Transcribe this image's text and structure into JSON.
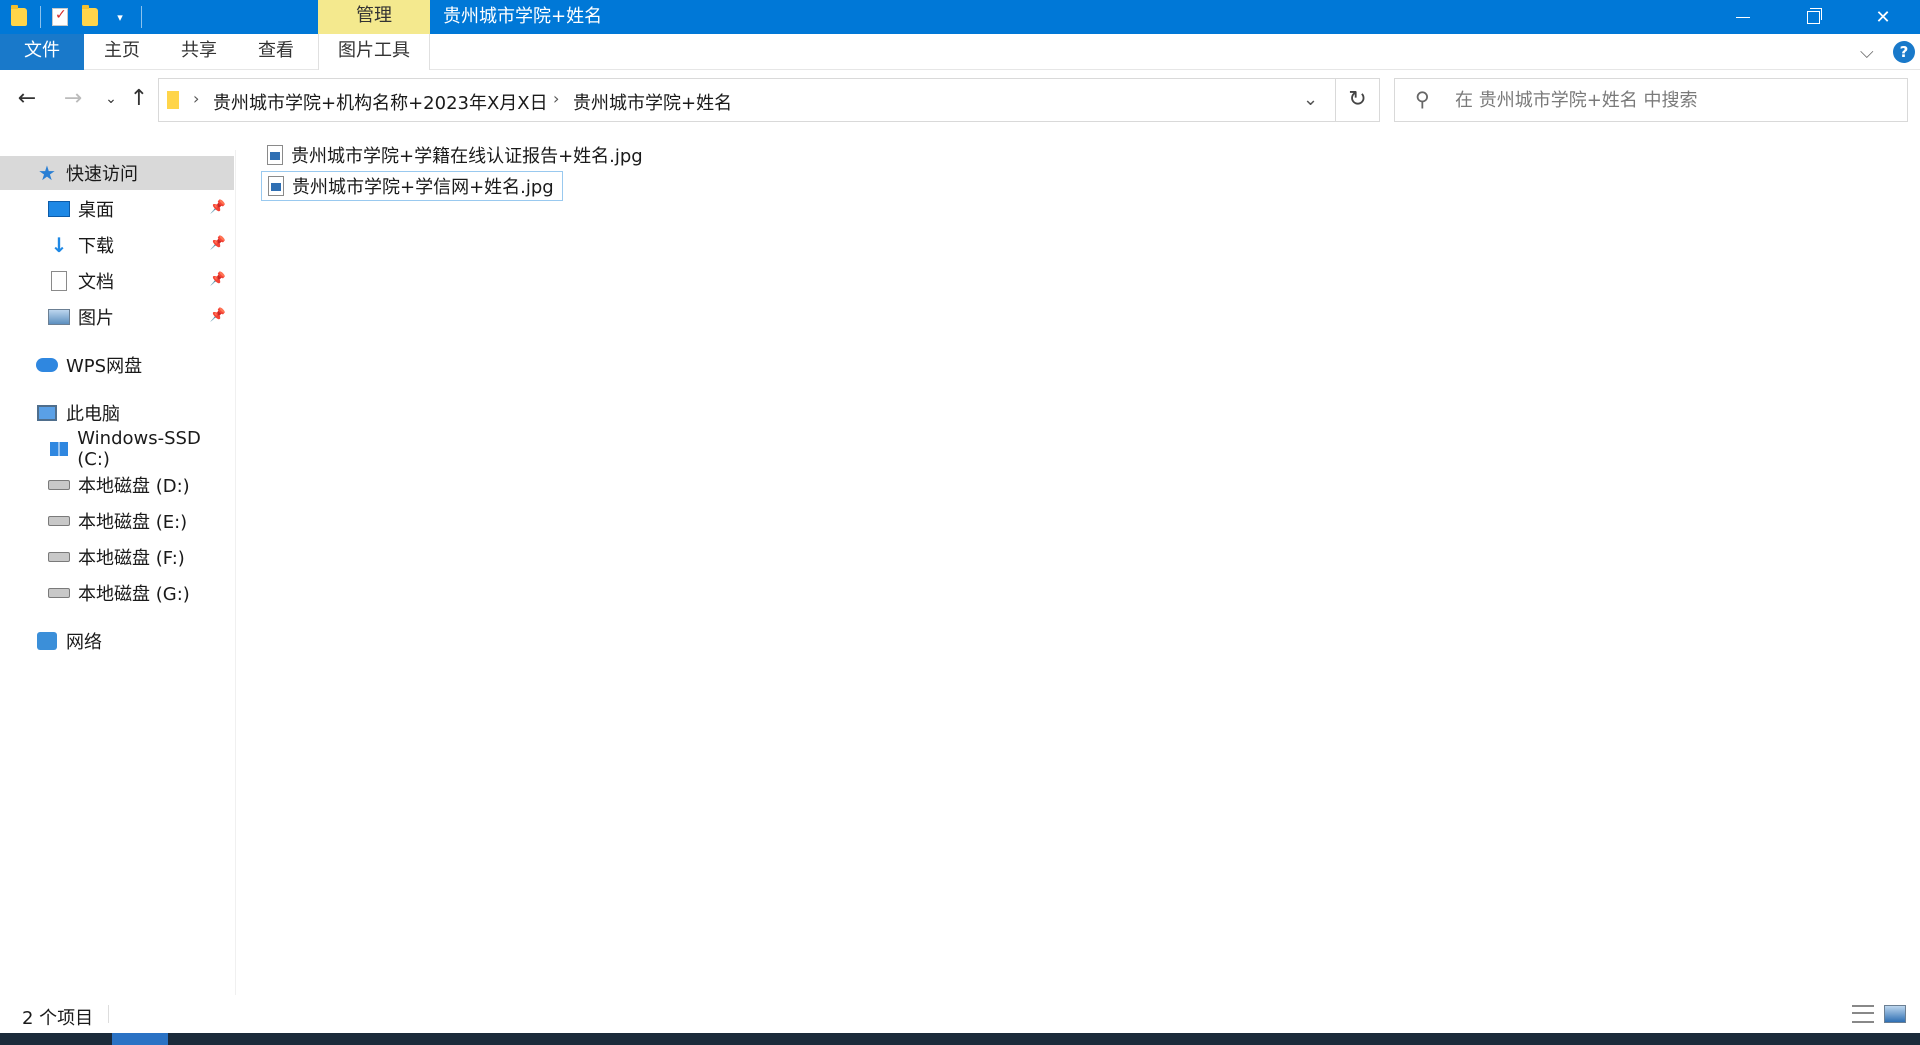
{
  "window": {
    "title": "贵州城市学院+姓名",
    "context_tab": "管理",
    "accent_color": "#0078d7"
  },
  "ribbon": {
    "tabs": [
      "文件",
      "主页",
      "共享",
      "查看",
      "图片工具"
    ]
  },
  "address": {
    "segments": [
      "贵州城市学院+机构名称+2023年X月X日",
      "贵州城市学院+姓名"
    ]
  },
  "search": {
    "placeholder": "在 贵州城市学院+姓名 中搜索"
  },
  "sidebar": {
    "quick_access": "快速访问",
    "pinned": [
      "桌面",
      "下载",
      "文档",
      "图片"
    ],
    "wps": "WPS网盘",
    "this_pc": "此电脑",
    "drives": [
      "Windows-SSD (C:)",
      "本地磁盘 (D:)",
      "本地磁盘 (E:)",
      "本地磁盘 (F:)",
      "本地磁盘 (G:)"
    ],
    "network": "网络"
  },
  "files": [
    {
      "name": "贵州城市学院+学籍在线认证报告+姓名.jpg",
      "icon": "image-file-icon"
    },
    {
      "name": "贵州城市学院+学信网+姓名.jpg",
      "icon": "image-file-icon"
    }
  ],
  "status": {
    "item_count": "2 个项目"
  }
}
